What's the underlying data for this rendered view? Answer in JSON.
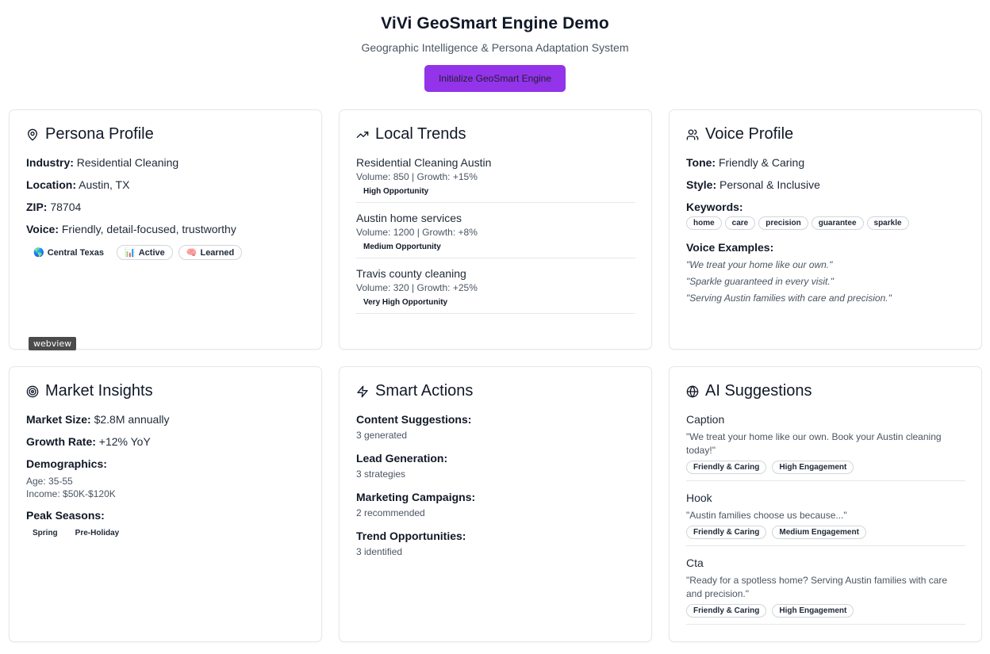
{
  "header": {
    "title": "ViVi GeoSmart Engine Demo",
    "subtitle": "Geographic Intelligence & Persona Adaptation System",
    "init_button": "Initialize GeoSmart Engine"
  },
  "persona": {
    "title": "Persona Profile",
    "icon": "map-pin-icon",
    "rows": [
      {
        "label": "Industry:",
        "value": " Residential Cleaning"
      },
      {
        "label": "Location:",
        "value": " Austin, TX"
      },
      {
        "label": "ZIP:",
        "value": " 78704"
      },
      {
        "label": "Voice:",
        "value": " Friendly, detail-focused, trustworthy"
      }
    ],
    "badges": [
      {
        "emoji": "🌎",
        "label": "Central Texas"
      },
      {
        "emoji": "📊",
        "label": "Active"
      },
      {
        "emoji": "🧠",
        "label": "Learned"
      }
    ]
  },
  "trends": {
    "title": "Local Trends",
    "icon": "trending-up-icon",
    "items": [
      {
        "name": "Residential Cleaning Austin",
        "meta": "Volume: 850 | Growth: +15%",
        "opportunity": "High Opportunity"
      },
      {
        "name": "Austin home services",
        "meta": "Volume: 1200 | Growth: +8%",
        "opportunity": "Medium Opportunity"
      },
      {
        "name": "Travis county cleaning",
        "meta": "Volume: 320 | Growth: +25%",
        "opportunity": "Very High Opportunity"
      }
    ]
  },
  "voice": {
    "title": "Voice Profile",
    "icon": "users-icon",
    "tone_label": "Tone:",
    "tone": " Friendly & Caring",
    "style_label": "Style:",
    "style": " Personal & Inclusive",
    "keywords_label": "Keywords:",
    "keywords": [
      "home",
      "care",
      "precision",
      "guarantee",
      "sparkle"
    ],
    "examples_label": "Voice Examples:",
    "examples": [
      "\"We treat your home like our own.\"",
      "\"Sparkle guaranteed in every visit.\"",
      "\"Serving Austin families with care and precision.\""
    ]
  },
  "market": {
    "title": "Market Insights",
    "icon": "target-icon",
    "size_label": "Market Size:",
    "size": " $2.8M annually",
    "growth_label": "Growth Rate:",
    "growth": " +12% YoY",
    "demo_label": "Demographics:",
    "age": "Age: 35-55",
    "income": "Income: $50K-$120K",
    "seasons_label": "Peak Seasons:",
    "seasons": [
      "Spring",
      "Pre-Holiday"
    ]
  },
  "actions": {
    "title": "Smart Actions",
    "icon": "zap-icon",
    "items": [
      {
        "label": "Content Suggestions:",
        "value": "3 generated"
      },
      {
        "label": "Lead Generation:",
        "value": "3 strategies"
      },
      {
        "label": "Marketing Campaigns:",
        "value": "2 recommended"
      },
      {
        "label": "Trend Opportunities:",
        "value": "3 identified"
      }
    ]
  },
  "suggestions": {
    "title": "AI Suggestions",
    "icon": "globe-icon",
    "items": [
      {
        "type": "Caption",
        "text": "\"We treat your home like our own. Book your Austin cleaning today!\"",
        "tags": [
          "Friendly & Caring",
          "High Engagement"
        ]
      },
      {
        "type": "Hook",
        "text": "\"Austin families choose us because...\"",
        "tags": [
          "Friendly & Caring",
          "Medium Engagement"
        ]
      },
      {
        "type": "Cta",
        "text": "\"Ready for a spotless home? Serving Austin families with care and precision.\"",
        "tags": [
          "Friendly & Caring",
          "High Engagement"
        ]
      }
    ]
  },
  "tooltip": "webview"
}
